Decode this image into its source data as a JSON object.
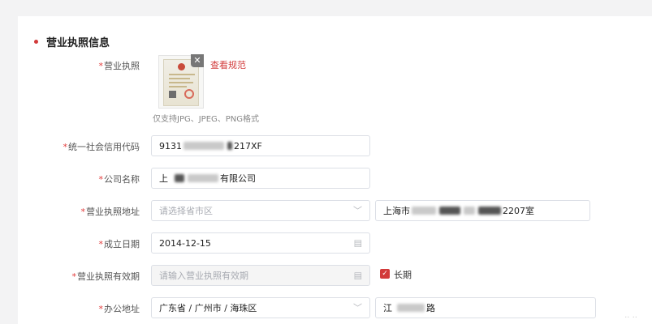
{
  "section": {
    "title": "营业执照信息"
  },
  "required_mark": "*",
  "license": {
    "label": "营业执照",
    "view_spec": "查看规范",
    "hint": "仅支持JPG、JPEG、PNG格式",
    "remove_icon": "close-icon"
  },
  "credit_code": {
    "label": "统一社会信用代码",
    "value_prefix": "9131",
    "value_suffix": "217XF"
  },
  "company_name": {
    "label": "公司名称",
    "value_prefix": "上",
    "value_suffix": "有限公司"
  },
  "license_address": {
    "label": "营业执照地址",
    "region_placeholder": "请选择省市区",
    "detail_prefix": "上海市",
    "detail_suffix": "2207室"
  },
  "found_date": {
    "label": "成立日期",
    "value": "2014-12-15"
  },
  "validity": {
    "label": "营业执照有效期",
    "placeholder": "请输入营业执照有效期",
    "long_term": "长期",
    "long_term_checked": true
  },
  "office_address": {
    "label": "办公地址",
    "region": "广东省 / 广州市 / 海珠区",
    "detail_prefix": "江",
    "detail_suffix": "路"
  },
  "colors": {
    "accent": "#d23a3a",
    "border": "#dcdfe6"
  }
}
